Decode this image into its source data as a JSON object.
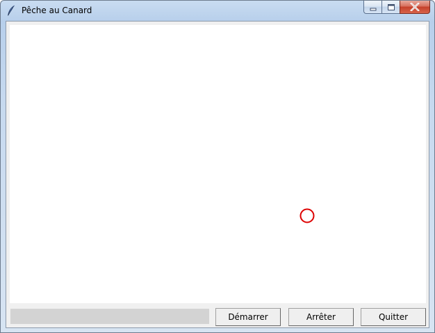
{
  "window": {
    "title": "Pêche au Canard",
    "app_icon": "feather-icon"
  },
  "caption_buttons": [
    "minimize-icon",
    "maximize-icon",
    "close-icon"
  ],
  "canvas": {
    "background": "#ffffff",
    "target": {
      "shape": "circle",
      "color": "#dd0000"
    }
  },
  "status_bar": {
    "color": "#d3d3d3"
  },
  "buttons": {
    "start_label": "Démarrer",
    "stop_label": "Arrêter",
    "quit_label": "Quitter"
  }
}
